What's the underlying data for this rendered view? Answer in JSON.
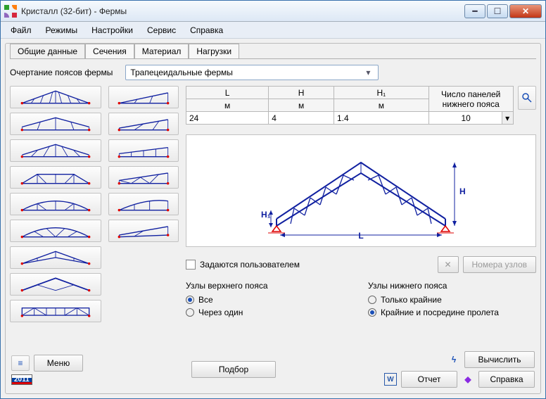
{
  "window": {
    "title": "Кристалл (32-бит) - Фермы"
  },
  "menu": {
    "items": [
      "Файл",
      "Режимы",
      "Настройки",
      "Сервис",
      "Справка"
    ]
  },
  "tabs": {
    "items": [
      "Общие данные",
      "Сечения",
      "Материал",
      "Нагрузки"
    ],
    "active": 0
  },
  "labels": {
    "outline": "Очертание поясов фермы",
    "user_defined": "Задаются пользователем",
    "nodes_button": "Номера узлов",
    "top_chord": "Узлы верхнего пояса",
    "bottom_chord": "Узлы нижнего пояса",
    "radio_all": "Все",
    "radio_every_other": "Через один",
    "radio_only_ends": "Только крайние",
    "radio_ends_mid": "Крайние и посредине пролета"
  },
  "combo": {
    "selected": "Трапецеидальные фермы"
  },
  "table": {
    "headers": [
      "L",
      "H",
      "H₁",
      "Число панелей нижнего пояса"
    ],
    "units": [
      "м",
      "м",
      "м",
      ""
    ],
    "values": [
      "24",
      "4",
      "1.4",
      "10"
    ]
  },
  "diagram": {
    "labels": {
      "L": "L",
      "H": "H",
      "H1": "H₁"
    }
  },
  "top_chord_selected": "all",
  "bottom_chord_selected": "ends_mid",
  "footer": {
    "menu": "Меню",
    "podbor": "Подбор",
    "calc": "Вычислить",
    "report": "Отчет",
    "help": "Справка",
    "year": "2011"
  }
}
